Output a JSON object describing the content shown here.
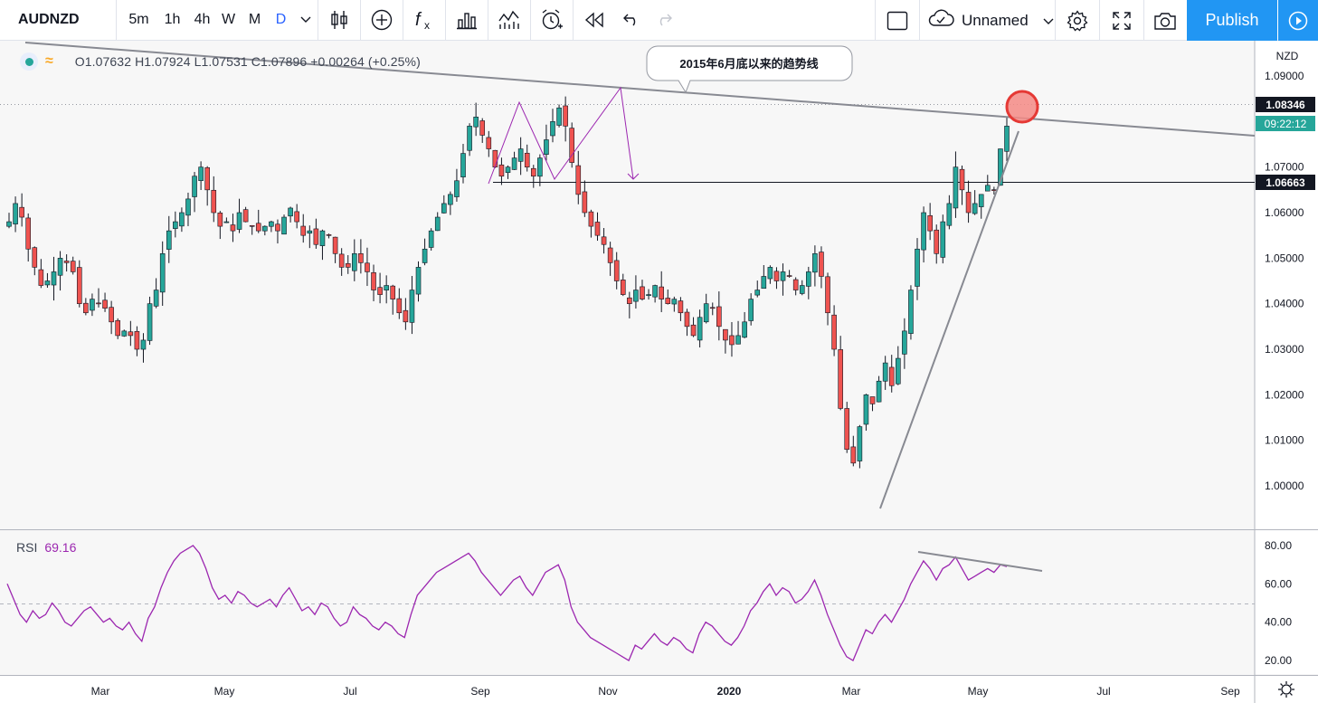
{
  "toolbar": {
    "symbol": "AUDNZD",
    "timeframes": [
      "5m",
      "1h",
      "4h",
      "W",
      "M",
      "D"
    ],
    "active_timeframe": "D",
    "layout_name": "Unnamed",
    "publish_label": "Publish",
    "icons": [
      "chevron-down-icon",
      "candles-icon",
      "plus-circle-icon",
      "fx-icon",
      "bar-chart-icon",
      "templates-icon",
      "alarm-icon",
      "replay-icon",
      "undo-icon",
      "redo-icon",
      "square-icon",
      "cloud-icon",
      "gear-icon",
      "fullscreen-icon",
      "camera-icon",
      "play-icon"
    ]
  },
  "legend": {
    "ohlc": "O1.07632  H1.07924  L1.07531  C1.07896  +0.00264 (+0.25%)"
  },
  "annotation": {
    "text": "2015年6月底以来的趋势线"
  },
  "price_axis": {
    "currency": "NZD",
    "ticks": [
      "1.09000",
      "1.08000",
      "1.07000",
      "1.06000",
      "1.05000",
      "1.04000",
      "1.03000",
      "1.02000",
      "1.01000",
      "1.00000"
    ],
    "current_price": "1.08346",
    "countdown": "09:22:12",
    "horizontal_line_label": "1.06663"
  },
  "rsi": {
    "label": "RSI",
    "value": "69.16",
    "ticks": [
      "80.00",
      "60.00",
      "40.00",
      "20.00"
    ]
  },
  "time_axis": {
    "labels": [
      "Mar",
      "May",
      "Jul",
      "Sep",
      "Nov",
      "2020",
      "Mar",
      "May",
      "Jul",
      "Sep"
    ]
  },
  "colors": {
    "up": "#26a69a",
    "down": "#ef5350",
    "accent": "#2196f3",
    "rsi": "#9c27b0",
    "drawing": "#9c27b0"
  },
  "chart_data": {
    "type": "candlestick",
    "symbol": "AUDNZD",
    "interval": "D",
    "ylim": [
      0.995,
      1.095
    ],
    "rsi_ylim": [
      15,
      85
    ],
    "closes": [
      1.058,
      1.062,
      1.059,
      1.052,
      1.048,
      1.044,
      1.045,
      1.047,
      1.05,
      1.049,
      1.047,
      1.04,
      1.038,
      1.041,
      1.04,
      1.039,
      1.036,
      1.033,
      1.034,
      1.033,
      1.03,
      1.032,
      1.04,
      1.043,
      1.051,
      1.056,
      1.058,
      1.06,
      1.063,
      1.068,
      1.07,
      1.065,
      1.06,
      1.057,
      1.058,
      1.056,
      1.06,
      1.058,
      1.057,
      1.056,
      1.057,
      1.058,
      1.056,
      1.059,
      1.061,
      1.058,
      1.055,
      1.056,
      1.053,
      1.056,
      1.055,
      1.051,
      1.048,
      1.048,
      1.051,
      1.049,
      1.047,
      1.043,
      1.042,
      1.044,
      1.041,
      1.038,
      1.036,
      1.043,
      1.048,
      1.052,
      1.056,
      1.059,
      1.062,
      1.064,
      1.067,
      1.073,
      1.079,
      1.081,
      1.077,
      1.074,
      1.07,
      1.068,
      1.07,
      1.072,
      1.074,
      1.07,
      1.068,
      1.072,
      1.076,
      1.08,
      1.083,
      1.079,
      1.071,
      1.064,
      1.06,
      1.057,
      1.055,
      1.053,
      1.049,
      1.045,
      1.042,
      1.04,
      1.043,
      1.041,
      1.042,
      1.044,
      1.041,
      1.04,
      1.041,
      1.038,
      1.035,
      1.033,
      1.037,
      1.04,
      1.039,
      1.035,
      1.032,
      1.031,
      1.033,
      1.036,
      1.041,
      1.043,
      1.046,
      1.048,
      1.045,
      1.047,
      1.046,
      1.043,
      1.044,
      1.047,
      1.051,
      1.046,
      1.038,
      1.03,
      1.017,
      1.008,
      1.005,
      1.013,
      1.02,
      1.018,
      1.023,
      1.027,
      1.022,
      1.028,
      1.034,
      1.043,
      1.052,
      1.06,
      1.056,
      1.051,
      1.058,
      1.062,
      1.07,
      1.065,
      1.06,
      1.062,
      1.064,
      1.066,
      1.065,
      1.074,
      1.079
    ],
    "rsi_values": [
      60,
      52,
      44,
      40,
      46,
      42,
      44,
      50,
      46,
      40,
      38,
      42,
      46,
      48,
      44,
      40,
      42,
      38,
      36,
      40,
      34,
      30,
      42,
      48,
      58,
      66,
      72,
      76,
      78,
      80,
      76,
      68,
      58,
      52,
      54,
      50,
      56,
      54,
      50,
      48,
      50,
      52,
      48,
      54,
      58,
      52,
      46,
      48,
      44,
      50,
      48,
      42,
      38,
      40,
      48,
      44,
      42,
      38,
      36,
      40,
      38,
      34,
      32,
      44,
      54,
      58,
      62,
      66,
      68,
      70,
      72,
      74,
      76,
      72,
      66,
      62,
      58,
      54,
      58,
      62,
      64,
      58,
      54,
      60,
      66,
      68,
      70,
      62,
      48,
      40,
      36,
      32,
      30,
      28,
      26,
      24,
      22,
      20,
      28,
      26,
      30,
      34,
      30,
      28,
      32,
      30,
      26,
      24,
      34,
      40,
      38,
      34,
      30,
      28,
      32,
      38,
      46,
      50,
      56,
      60,
      54,
      58,
      56,
      50,
      52,
      56,
      62,
      54,
      44,
      36,
      28,
      22,
      20,
      28,
      36,
      34,
      40,
      44,
      40,
      46,
      52,
      60,
      66,
      72,
      68,
      62,
      68,
      70,
      74,
      68,
      62,
      64,
      66,
      68,
      66,
      70,
      69
    ]
  }
}
